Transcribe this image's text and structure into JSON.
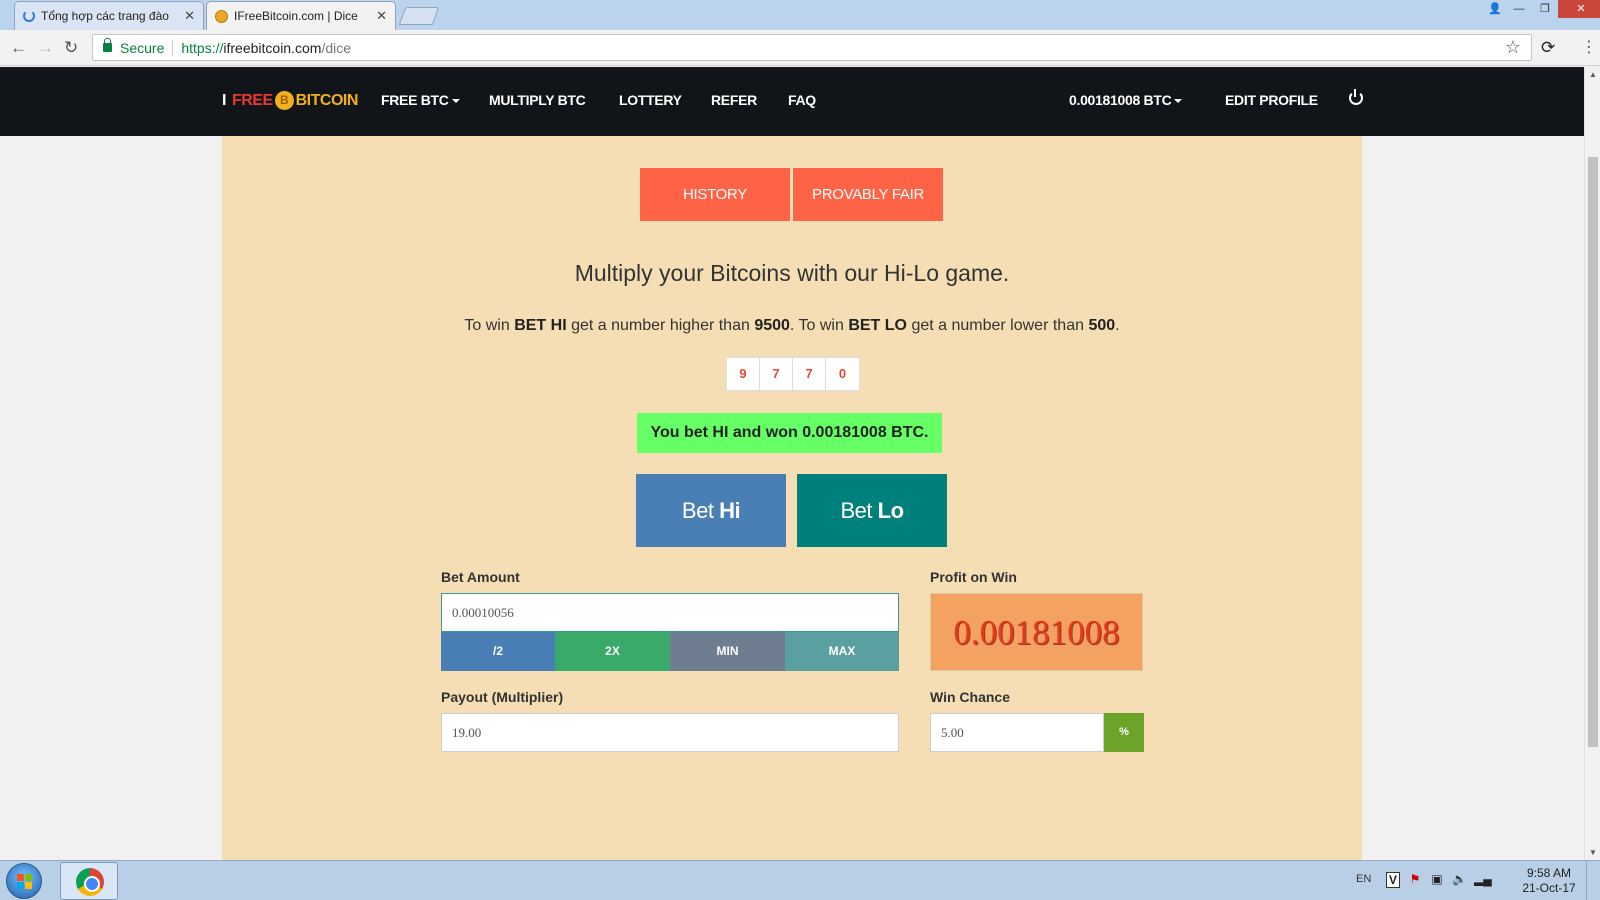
{
  "browser": {
    "tabs": [
      {
        "title": "Tổng hợp các trang đào"
      },
      {
        "title": "IFreeBitcoin.com | Dice"
      }
    ],
    "security_label": "Secure",
    "url_scheme": "https://",
    "url_host": "ifreebitcoin.com",
    "url_path": "/dice"
  },
  "nav": {
    "logo": {
      "part1": "I",
      "part2": "FREE",
      "coin": "B",
      "part3": "BITCOIN"
    },
    "items": [
      "FREE BTC",
      "MULTIPLY BTC",
      "LOTTERY",
      "REFER",
      "FAQ"
    ],
    "balance": "0.00181008 BTC",
    "edit_profile": "EDIT PROFILE"
  },
  "game": {
    "history_label": "HISTORY",
    "provably_fair_label": "PROVABLY FAIR",
    "headline": "Multiply your Bitcoins with our Hi-Lo game.",
    "rules": {
      "p1": "To win ",
      "bet_hi": "BET HI",
      "p2": " get a number higher than ",
      "hi_threshold": "9500",
      "p3": ". To win ",
      "bet_lo": "BET LO",
      "p4": " get a number lower than ",
      "lo_threshold": "500",
      "p5": "."
    },
    "digits": [
      "9",
      "7",
      "7",
      "0"
    ],
    "result_message": "You bet HI and won 0.00181008 BTC.",
    "bet_hi": {
      "prefix": "Bet ",
      "strong": "Hi"
    },
    "bet_lo": {
      "prefix": "Bet ",
      "strong": "Lo"
    },
    "bet_amount_label": "Bet Amount",
    "bet_amount_value": "0.00010056",
    "quick_buttons": [
      "/2",
      "2X",
      "MIN",
      "MAX"
    ],
    "profit_label": "Profit on Win",
    "profit_value": "0.00181008",
    "payout_label": "Payout (Multiplier)",
    "payout_value": "19.00",
    "win_chance_label": "Win Chance",
    "win_chance_value": "5.00",
    "percent_symbol": "%"
  },
  "taskbar": {
    "language": "EN",
    "time": "9:58 AM",
    "date": "21-Oct-17"
  },
  "colors": {
    "nav_bg": "#111419",
    "panel_bg": "#f5deb4",
    "top_button": "#fe6346",
    "bet_hi": "#4a7fb5",
    "bet_lo": "#00807c",
    "result_bg": "#66ff66",
    "profit_bg": "#f4a261"
  }
}
